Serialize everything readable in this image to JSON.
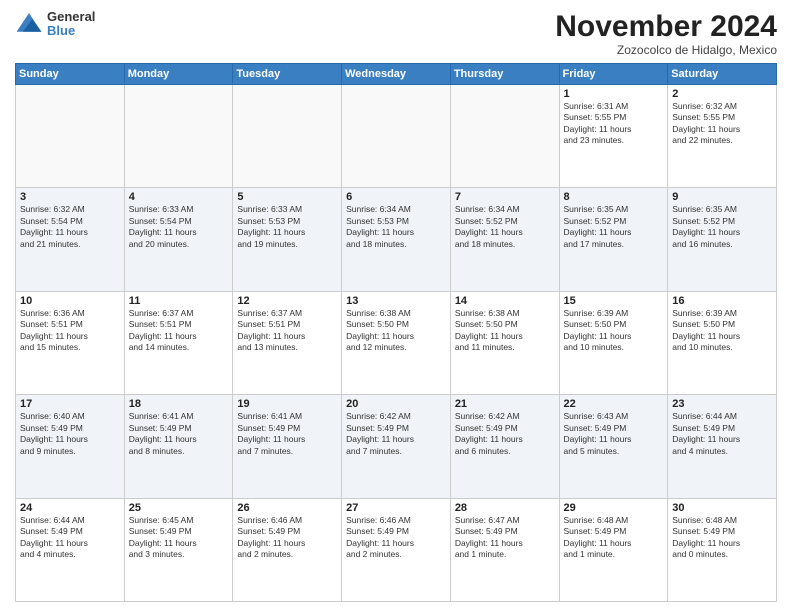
{
  "header": {
    "logo_general": "General",
    "logo_blue": "Blue",
    "month_title": "November 2024",
    "location": "Zozocolco de Hidalgo, Mexico"
  },
  "weekdays": [
    "Sunday",
    "Monday",
    "Tuesday",
    "Wednesday",
    "Thursday",
    "Friday",
    "Saturday"
  ],
  "weeks": [
    [
      {
        "day": "",
        "info": ""
      },
      {
        "day": "",
        "info": ""
      },
      {
        "day": "",
        "info": ""
      },
      {
        "day": "",
        "info": ""
      },
      {
        "day": "",
        "info": ""
      },
      {
        "day": "1",
        "info": "Sunrise: 6:31 AM\nSunset: 5:55 PM\nDaylight: 11 hours\nand 23 minutes."
      },
      {
        "day": "2",
        "info": "Sunrise: 6:32 AM\nSunset: 5:55 PM\nDaylight: 11 hours\nand 22 minutes."
      }
    ],
    [
      {
        "day": "3",
        "info": "Sunrise: 6:32 AM\nSunset: 5:54 PM\nDaylight: 11 hours\nand 21 minutes."
      },
      {
        "day": "4",
        "info": "Sunrise: 6:33 AM\nSunset: 5:54 PM\nDaylight: 11 hours\nand 20 minutes."
      },
      {
        "day": "5",
        "info": "Sunrise: 6:33 AM\nSunset: 5:53 PM\nDaylight: 11 hours\nand 19 minutes."
      },
      {
        "day": "6",
        "info": "Sunrise: 6:34 AM\nSunset: 5:53 PM\nDaylight: 11 hours\nand 18 minutes."
      },
      {
        "day": "7",
        "info": "Sunrise: 6:34 AM\nSunset: 5:52 PM\nDaylight: 11 hours\nand 18 minutes."
      },
      {
        "day": "8",
        "info": "Sunrise: 6:35 AM\nSunset: 5:52 PM\nDaylight: 11 hours\nand 17 minutes."
      },
      {
        "day": "9",
        "info": "Sunrise: 6:35 AM\nSunset: 5:52 PM\nDaylight: 11 hours\nand 16 minutes."
      }
    ],
    [
      {
        "day": "10",
        "info": "Sunrise: 6:36 AM\nSunset: 5:51 PM\nDaylight: 11 hours\nand 15 minutes."
      },
      {
        "day": "11",
        "info": "Sunrise: 6:37 AM\nSunset: 5:51 PM\nDaylight: 11 hours\nand 14 minutes."
      },
      {
        "day": "12",
        "info": "Sunrise: 6:37 AM\nSunset: 5:51 PM\nDaylight: 11 hours\nand 13 minutes."
      },
      {
        "day": "13",
        "info": "Sunrise: 6:38 AM\nSunset: 5:50 PM\nDaylight: 11 hours\nand 12 minutes."
      },
      {
        "day": "14",
        "info": "Sunrise: 6:38 AM\nSunset: 5:50 PM\nDaylight: 11 hours\nand 11 minutes."
      },
      {
        "day": "15",
        "info": "Sunrise: 6:39 AM\nSunset: 5:50 PM\nDaylight: 11 hours\nand 10 minutes."
      },
      {
        "day": "16",
        "info": "Sunrise: 6:39 AM\nSunset: 5:50 PM\nDaylight: 11 hours\nand 10 minutes."
      }
    ],
    [
      {
        "day": "17",
        "info": "Sunrise: 6:40 AM\nSunset: 5:49 PM\nDaylight: 11 hours\nand 9 minutes."
      },
      {
        "day": "18",
        "info": "Sunrise: 6:41 AM\nSunset: 5:49 PM\nDaylight: 11 hours\nand 8 minutes."
      },
      {
        "day": "19",
        "info": "Sunrise: 6:41 AM\nSunset: 5:49 PM\nDaylight: 11 hours\nand 7 minutes."
      },
      {
        "day": "20",
        "info": "Sunrise: 6:42 AM\nSunset: 5:49 PM\nDaylight: 11 hours\nand 7 minutes."
      },
      {
        "day": "21",
        "info": "Sunrise: 6:42 AM\nSunset: 5:49 PM\nDaylight: 11 hours\nand 6 minutes."
      },
      {
        "day": "22",
        "info": "Sunrise: 6:43 AM\nSunset: 5:49 PM\nDaylight: 11 hours\nand 5 minutes."
      },
      {
        "day": "23",
        "info": "Sunrise: 6:44 AM\nSunset: 5:49 PM\nDaylight: 11 hours\nand 4 minutes."
      }
    ],
    [
      {
        "day": "24",
        "info": "Sunrise: 6:44 AM\nSunset: 5:49 PM\nDaylight: 11 hours\nand 4 minutes."
      },
      {
        "day": "25",
        "info": "Sunrise: 6:45 AM\nSunset: 5:49 PM\nDaylight: 11 hours\nand 3 minutes."
      },
      {
        "day": "26",
        "info": "Sunrise: 6:46 AM\nSunset: 5:49 PM\nDaylight: 11 hours\nand 2 minutes."
      },
      {
        "day": "27",
        "info": "Sunrise: 6:46 AM\nSunset: 5:49 PM\nDaylight: 11 hours\nand 2 minutes."
      },
      {
        "day": "28",
        "info": "Sunrise: 6:47 AM\nSunset: 5:49 PM\nDaylight: 11 hours\nand 1 minute."
      },
      {
        "day": "29",
        "info": "Sunrise: 6:48 AM\nSunset: 5:49 PM\nDaylight: 11 hours\nand 1 minute."
      },
      {
        "day": "30",
        "info": "Sunrise: 6:48 AM\nSunset: 5:49 PM\nDaylight: 11 hours\nand 0 minutes."
      }
    ]
  ]
}
